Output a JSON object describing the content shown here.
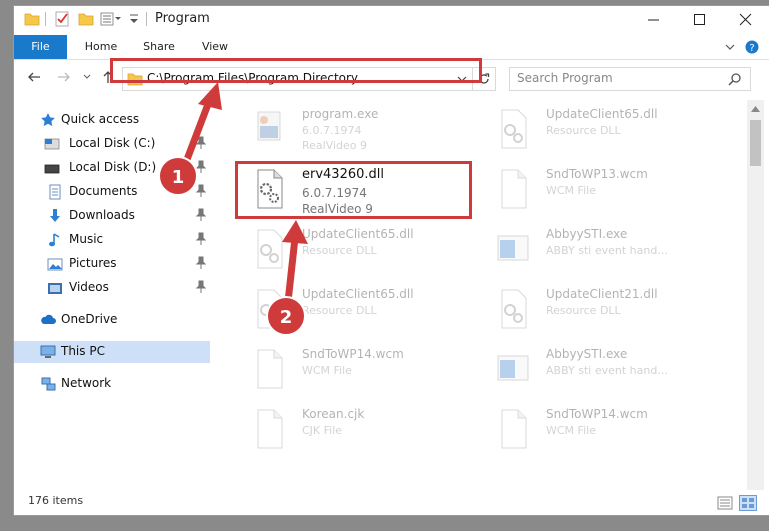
{
  "window": {
    "title": "Program"
  },
  "ribbon": {
    "tabs": [
      "File",
      "Home",
      "Share",
      "View"
    ]
  },
  "address": {
    "path": "C:\\Program Files\\Program Directory"
  },
  "search": {
    "placeholder": "Search Program"
  },
  "nav": {
    "quick_access": "Quick access",
    "items": [
      {
        "label": "Local Disk (C:)",
        "icon": "drive-icon"
      },
      {
        "label": "Local Disk (D:)",
        "icon": "drive-icon"
      },
      {
        "label": "Documents",
        "icon": "documents-icon"
      },
      {
        "label": "Downloads",
        "icon": "downloads-icon"
      },
      {
        "label": "Music",
        "icon": "music-icon"
      },
      {
        "label": "Pictures",
        "icon": "pictures-icon"
      },
      {
        "label": "Videos",
        "icon": "videos-icon"
      }
    ],
    "onedrive": "OneDrive",
    "this_pc": "This PC",
    "network": "Network"
  },
  "files": [
    {
      "name": "program.exe",
      "line1": "6.0.7.1974",
      "line2": "RealVideo 9",
      "icon": "program-icon"
    },
    {
      "name": "UpdateClient65.dll",
      "line1": "Resource DLL",
      "icon": "dll-icon"
    },
    {
      "name": "erv43260.dll",
      "line1": "6.0.7.1974",
      "line2": "RealVideo 9",
      "icon": "gears-file-icon"
    },
    {
      "name": "SndToWP13.wcm",
      "line1": "WCM File",
      "icon": "blank-file-icon"
    },
    {
      "name": "UpdateClient65.dll",
      "line1": "Resource DLL",
      "icon": "dll-icon"
    },
    {
      "name": "AbbyySTI.exe",
      "line1": "ABBY sti event hand...",
      "icon": "window-app-icon"
    },
    {
      "name": "UpdateClient65.dll",
      "line1": "Resource DLL",
      "icon": "dll-icon"
    },
    {
      "name": "UpdateClient21.dll",
      "line1": "Resource DLL",
      "icon": "dll-icon"
    },
    {
      "name": "SndToWP14.wcm",
      "line1": "WCM File",
      "icon": "blank-file-icon"
    },
    {
      "name": "AbbyySTI.exe",
      "line1": "ABBY sti event hand...",
      "icon": "window-app-icon"
    },
    {
      "name": "Korean.cjk",
      "line1": "CJK File",
      "icon": "blank-file-icon"
    },
    {
      "name": "SndToWP14.wcm",
      "line1": "WCM File",
      "icon": "blank-file-icon"
    }
  ],
  "status": {
    "items": "176 items"
  },
  "annotations": {
    "step1": "1",
    "step2": "2",
    "color": "#cf3a3a"
  }
}
